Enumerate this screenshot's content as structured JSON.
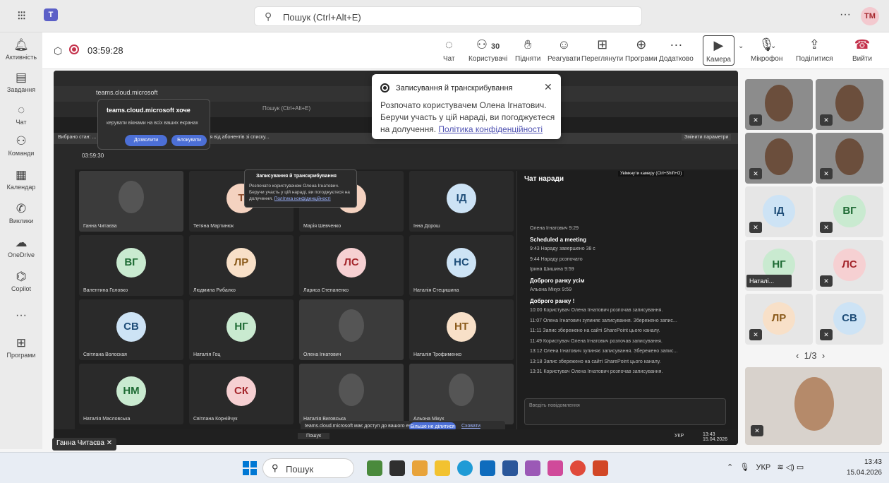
{
  "topbar": {
    "search_placeholder": "Пошук (Ctrl+Alt+E)",
    "more": "···",
    "avatar": "TM"
  },
  "rail": [
    {
      "icon": "bell-icon",
      "label": "Активність"
    },
    {
      "icon": "tasks-icon",
      "label": "Завдання"
    },
    {
      "icon": "chat-icon",
      "label": "Чат"
    },
    {
      "icon": "teams-icon",
      "label": "Команди"
    },
    {
      "icon": "calendar-icon",
      "label": "Календар"
    },
    {
      "icon": "calls-icon",
      "label": "Виклики"
    },
    {
      "icon": "onedrive-icon",
      "label": "OneDrive"
    },
    {
      "icon": "copilot-icon",
      "label": "Copilot"
    },
    {
      "icon": "more-icon",
      "label": "···"
    },
    {
      "icon": "apps-icon",
      "label": "Програми"
    }
  ],
  "meeting": {
    "timer": "03:59:28",
    "people_count": "30",
    "toolbar": {
      "chat": "Чат",
      "people": "Користувачі",
      "raise": "Підняти",
      "react": "Реагувати",
      "view": "Переглянути",
      "apps": "Програми",
      "more": "Додатково",
      "camera": "Камера",
      "mic": "Мікрофон",
      "share": "Поділитися",
      "leave": "Вийти"
    }
  },
  "recording_popup": {
    "title": "Записування й транскрибування",
    "body": "Розпочато користувачем Олена Ігнатович. Беручи участь у цій нараді, ви погоджуєтеся на долучення.",
    "link": "Політика конфіденційності"
  },
  "inner": {
    "url": "teams.cloud.microsoft",
    "permission_title": "teams.cloud.microsoft хоче",
    "permission_desc": "керувати вікнами на всіх ваших екранах",
    "allow": "Дозволити",
    "block": "Блокувати",
    "banner": "Вибрано стан: ... вище про термінові повідомлення й повідомлення від абонентів зі списку...",
    "search": "Пошук (Ctrl+Alt+E)",
    "timer": "03:59:30",
    "camera_tip": "Увімкнути камеру (Ctrl+Shift+O)",
    "change_settings": "Змінити параметри",
    "rec_small_title": "Записування й транскрибування",
    "rec_small_body": "Розпочато користувачем Олена Ігнатович. Беручи участь у цій нараді, ви погоджуєтеся на долучення.",
    "rec_small_link": "Політика конфіденційності",
    "share_text": "teams.cloud.microsoft має доступ до вашого екрана.",
    "share_stop": "Більше не ділитися",
    "share_hide": "Сховати",
    "taskbar_search": "Пошук",
    "taskbar_time": "13:43",
    "taskbar_date": "15.04.2026",
    "taskbar_lang": "УКР"
  },
  "tiles": [
    {
      "initials": "",
      "name": "Ганна Читаєва",
      "color": "#2a2a2a",
      "fg": "#fff",
      "photo": true
    },
    {
      "initials": "Т",
      "name": "Тетяна Мартинюк",
      "color": "#f4d2c0",
      "fg": "#8a4a2a",
      "photo": false
    },
    {
      "initials": "Ш",
      "name": "Марія Шевченко",
      "color": "#f4d2c0",
      "fg": "#8a4a2a",
      "photo": false
    },
    {
      "initials": "ІД",
      "name": "Інна Дорош",
      "color": "#cde3f5",
      "fg": "#1f4e79",
      "photo": false
    },
    {
      "initials": "ВГ",
      "name": "Валентина Головко",
      "color": "#c9ead0",
      "fg": "#1e6b34",
      "photo": false
    },
    {
      "initials": "ЛР",
      "name": "Людмила Рибалко",
      "color": "#f8e0c8",
      "fg": "#8a5a1a",
      "photo": false
    },
    {
      "initials": "ЛС",
      "name": "Лариса Степаненко",
      "color": "#f6d0d2",
      "fg": "#a4262c",
      "photo": false
    },
    {
      "initials": "НС",
      "name": "Наталія Стецишина",
      "color": "#cde3f5",
      "fg": "#1f4e79",
      "photo": false
    },
    {
      "initials": "СВ",
      "name": "Світлана Волоская",
      "color": "#cde3f5",
      "fg": "#1f4e79",
      "photo": false
    },
    {
      "initials": "НГ",
      "name": "Наталія Гоц",
      "color": "#c9ead0",
      "fg": "#1e6b34",
      "photo": false
    },
    {
      "initials": "",
      "name": "Олена Ігнатович",
      "color": "#4a4a4a",
      "fg": "#fff",
      "photo": true
    },
    {
      "initials": "НТ",
      "name": "Наталія Трофименко",
      "color": "#f8e0c8",
      "fg": "#8a5a1a",
      "photo": false
    },
    {
      "initials": "НМ",
      "name": "Наталія Масловська",
      "color": "#c9ead0",
      "fg": "#1e6b34",
      "photo": false
    },
    {
      "initials": "СК",
      "name": "Світлана Корнійчук",
      "color": "#f6d0d2",
      "fg": "#a4262c",
      "photo": false
    },
    {
      "initials": "",
      "name": "Наталія Виговська",
      "color": "#3b3b3b",
      "fg": "#fff",
      "photo": true
    },
    {
      "initials": "",
      "name": "Альона Мікух",
      "color": "#3b3b3b",
      "fg": "#fff",
      "photo": true
    }
  ],
  "chat": {
    "title": "Чат наради",
    "messages": [
      {
        "text": "Олена Ігнатович 9:29",
        "bold": false
      },
      {
        "text": "Scheduled a meeting",
        "bold": true
      },
      {
        "text": "9:43 Нараду завершено 38 с",
        "bold": false
      },
      {
        "text": "9:44 Нараду розпочато",
        "bold": false
      },
      {
        "text": "Ірина Шишина 9:59",
        "bold": false
      },
      {
        "text": "Доброго ранку усім",
        "bold": true
      },
      {
        "text": "Альона Мікух 9:59",
        "bold": false
      },
      {
        "text": "Доброго ранку !",
        "bold": true
      },
      {
        "text": "10:00 Користувач Олена Ігнатович розпочав записування.",
        "bold": false
      },
      {
        "text": "11:07 Олена Ігнатович зупиняє записування. Збережено запис...",
        "bold": false
      },
      {
        "text": "11:11 Запис збережено на сайті SharePoint цього каналу.",
        "bold": false
      },
      {
        "text": "11:49 Користувач Олена Ігнатович розпочав записування.",
        "bold": false
      },
      {
        "text": "13:12 Олена Ігнатович зупиняє записування. Збережено запис...",
        "bold": false
      },
      {
        "text": "13:18 Запис збережено на сайті SharePoint цього каналу.",
        "bold": false
      },
      {
        "text": "13:31 Користувач Олена Ігнатович розпочав записування.",
        "bold": false
      }
    ],
    "input_placeholder": "Введіть повідомлення"
  },
  "gallery": [
    {
      "initials": "",
      "photo": true
    },
    {
      "initials": "",
      "photo": true
    },
    {
      "initials": "",
      "photo": true
    },
    {
      "initials": "",
      "photo": true
    },
    {
      "initials": "ІД",
      "color": "#cde3f5",
      "fg": "#1f4e79"
    },
    {
      "initials": "ВГ",
      "color": "#c9ead0",
      "fg": "#1e6b34"
    },
    {
      "initials": "НГ",
      "color": "#c9ead0",
      "fg": "#1e6b34"
    },
    {
      "initials": "ЛС",
      "color": "#f6d0d2",
      "fg": "#a4262c"
    },
    {
      "initials": "ЛР",
      "color": "#f8e0c8",
      "fg": "#8a5a1a"
    },
    {
      "initials": "СВ",
      "color": "#cde3f5",
      "fg": "#1f4e79"
    }
  ],
  "gallery_label": "Наталі...",
  "pager": "1/3",
  "speaker": "Ганна Читаєва",
  "taskbar": {
    "search": "Пошук",
    "lang": "УКР",
    "time": "13:43",
    "date": "15.04.2026"
  }
}
